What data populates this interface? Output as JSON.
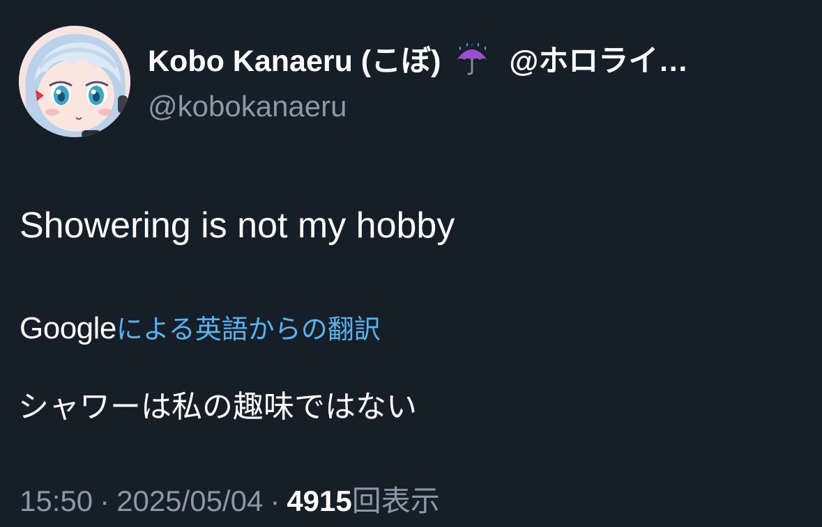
{
  "author": {
    "display_name": "Kobo Kanaeru (こぼ)",
    "name_icon": "umbrella-with-rain-icon",
    "affiliation": "@ホロライ…",
    "handle": "@kobokanaeru"
  },
  "tweet": {
    "text": "Showering is not my hobby"
  },
  "translation": {
    "provider": "Google",
    "attribution": "による英語からの翻訳",
    "text": "シャワーは私の趣味ではない"
  },
  "meta": {
    "time": "15:50",
    "separator": "·",
    "date": "2025/05/04",
    "views_count": "4915",
    "views_label": "回表示"
  },
  "colors": {
    "background": "#161e28",
    "primary_text": "#ffffff",
    "secondary_text": "#8b98a5",
    "link": "#58b3f0"
  }
}
